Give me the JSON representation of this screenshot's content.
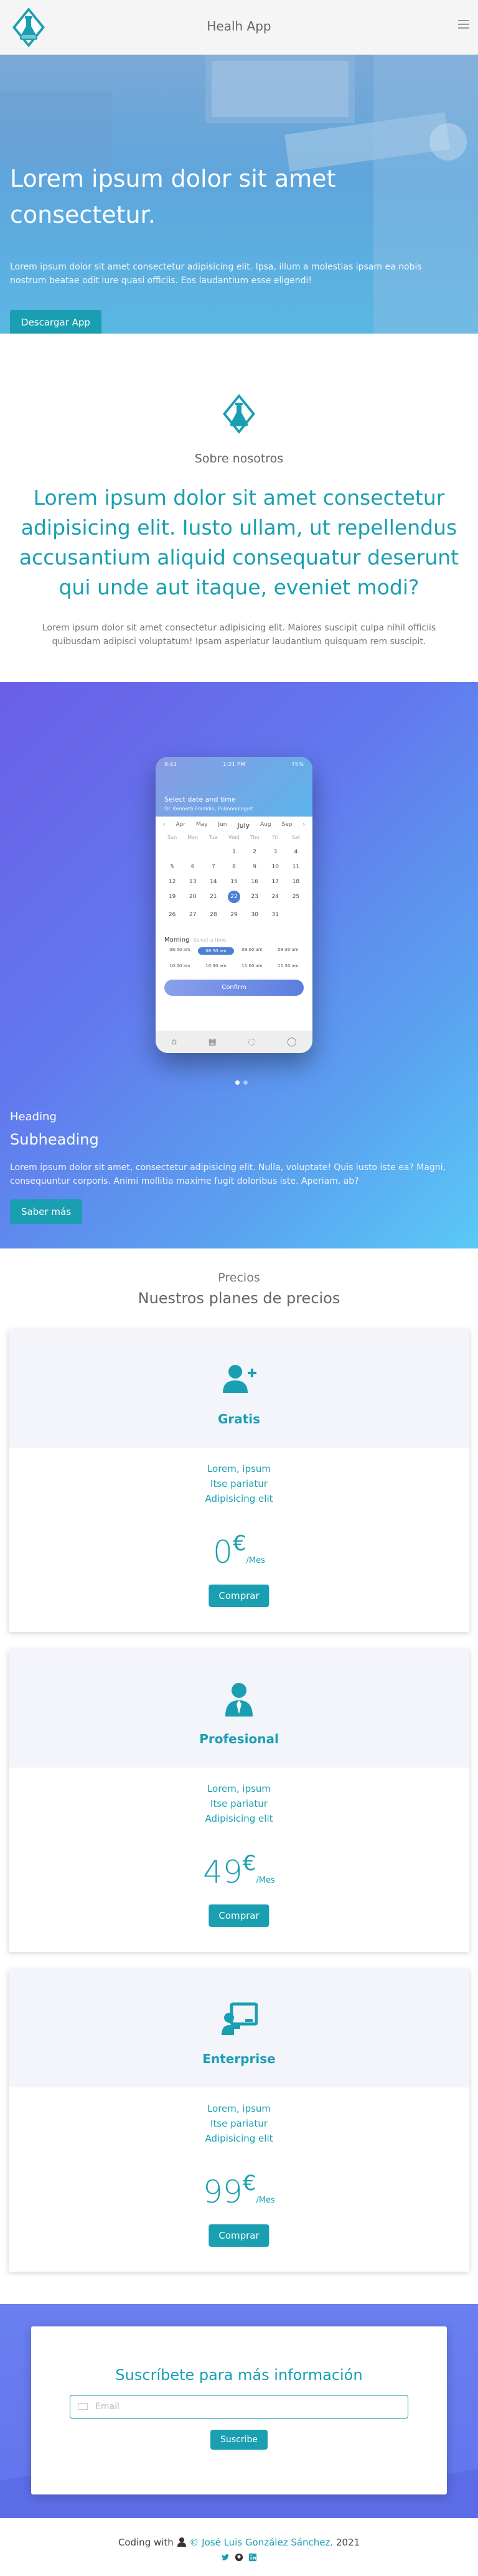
{
  "navbar": {
    "brand": "Healh App"
  },
  "hero": {
    "title": "Lorem ipsum dolor sit amet consectetur.",
    "text": "Lorem ipsum dolor sit amet consectetur adipisicing elit. Ipsa, illum a molestias ipsam ea nobis nostrum beatae odit iure quasi officiis. Eos laudantium esse eligendi!",
    "button": "Descargar App"
  },
  "about": {
    "eyebrow": "Sobre nosotros",
    "title": "Lorem ipsum dolor sit amet consectetur adipisicing elit. Iusto ullam, ut repellendus accusantium aliquid consequatur deserunt qui unde aut itaque, eveniet modi?",
    "text": "Lorem ipsum dolor sit amet consectetur adipisicing elit. Maiores suscipit culpa nihil officiis quibusdam adipisci voluptatum! Ipsam asperiatur laudantium quisquam rem suscipit."
  },
  "feature": {
    "phone": {
      "status_left": "9:41",
      "status_center": "1:21 PM",
      "status_right": "75%",
      "title": "Select date and time",
      "subtitle": "Dr. Kenneth Franklin, Pulmonologist",
      "months": [
        "Apr",
        "May",
        "Jun",
        "July",
        "Aug",
        "Sep"
      ],
      "active_month": "July",
      "day_names": [
        "Sun",
        "Mon",
        "Tue",
        "Wed",
        "Thu",
        "Fri",
        "Sat"
      ],
      "days": [
        "",
        "",
        "",
        "1",
        "2",
        "3",
        "4",
        "5",
        "6",
        "7",
        "8",
        "9",
        "10",
        "11",
        "12",
        "13",
        "14",
        "15",
        "16",
        "17",
        "18",
        "19",
        "20",
        "21",
        "22",
        "23",
        "24",
        "25",
        "26",
        "27",
        "28",
        "29",
        "30",
        "31",
        "",
        ""
      ],
      "selected_day": "22",
      "period": "Morning",
      "period_note": "Select a time",
      "times": [
        "08:00 am",
        "08:30 am",
        "09:00 am",
        "09:30 am",
        "10:00 am",
        "10:30 am",
        "11:00 am",
        "11:30 am"
      ],
      "selected_time": "08:30 am",
      "confirm": "Confirm"
    },
    "heading": "Heading",
    "subheading": "Subheading",
    "text": "Lorem ipsum dolor sit amet, consectetur adipisicing elit. Nulla, voluptate! Quis iusto iste ea? Magni, consequuntur corporis. Animi mollitia maxime fugit doloribus iste. Aperiam, ab?",
    "button": "Saber más"
  },
  "pricing": {
    "eyebrow": "Precios",
    "title": "Nuestros planes de precios",
    "plans": [
      {
        "name": "Gratis",
        "icon": "user-plus-icon",
        "features": [
          "Lorem, ipsum",
          "Itse pariatur",
          "Adipisicing elit"
        ],
        "price": "0",
        "currency": "€",
        "period": "/Mes",
        "button": "Comprar"
      },
      {
        "name": "Profesional",
        "icon": "user-tie-icon",
        "features": [
          "Lorem, ipsum",
          "Itse pariatur",
          "Adipisicing elit"
        ],
        "price": "49",
        "currency": "€",
        "period": "/Mes",
        "button": "Comprar"
      },
      {
        "name": "Enterprise",
        "icon": "chalkboard-teacher-icon",
        "features": [
          "Lorem, ipsum",
          "Itse pariatur",
          "Adipisicing elit"
        ],
        "price": "99",
        "currency": "€",
        "period": "/Mes",
        "button": "Comprar"
      }
    ]
  },
  "subscribe": {
    "title": "Suscríbete para más información",
    "placeholder": "Email",
    "button": "Suscribe"
  },
  "footer": {
    "prefix": "Coding with",
    "copyright": "©",
    "author": "José Luis González Sánchez.",
    "year": "2021"
  },
  "colors": {
    "accent": "#199fb1",
    "gradient_start": "#6a5fe6",
    "gradient_end": "#5ac9f7"
  }
}
